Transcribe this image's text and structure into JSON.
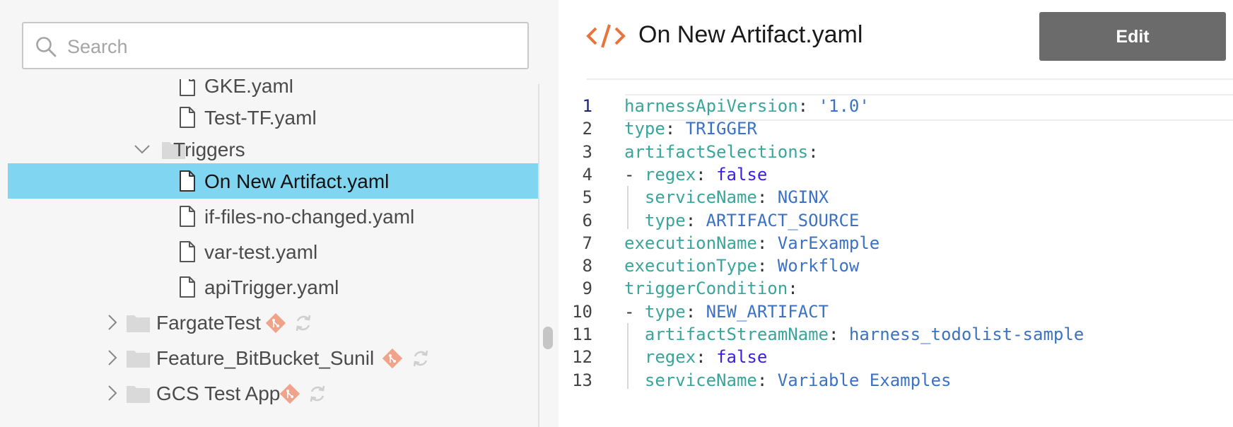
{
  "search": {
    "placeholder": "Search",
    "value": ""
  },
  "tree": {
    "items": [
      {
        "type": "file",
        "label": "GKE.yaml",
        "selected": false
      },
      {
        "type": "file",
        "label": "Test-TF.yaml",
        "selected": false
      },
      {
        "type": "folder",
        "label": "Triggers",
        "expanded": true
      },
      {
        "type": "file",
        "label": "On New Artifact.yaml",
        "selected": true
      },
      {
        "type": "file",
        "label": "if-files-no-changed.yaml",
        "selected": false
      },
      {
        "type": "file",
        "label": "var-test.yaml",
        "selected": false
      },
      {
        "type": "file",
        "label": "apiTrigger.yaml",
        "selected": false
      },
      {
        "type": "folder",
        "label": "FargateTest",
        "expanded": false,
        "git": true
      },
      {
        "type": "folder",
        "label": "Feature_BitBucket_Sunil",
        "expanded": false,
        "git": true
      },
      {
        "type": "folder",
        "label": "GCS Test App",
        "expanded": false,
        "git": true
      }
    ]
  },
  "editor": {
    "file_title": "On New Artifact.yaml",
    "edit_label": "Edit",
    "active_line": 1,
    "lines": [
      {
        "num": "1",
        "tokens": [
          [
            "key",
            "harnessApiVersion"
          ],
          [
            "punc",
            ": "
          ],
          [
            "str",
            "'1.0'"
          ]
        ]
      },
      {
        "num": "2",
        "tokens": [
          [
            "key",
            "type"
          ],
          [
            "punc",
            ": "
          ],
          [
            "val",
            "TRIGGER"
          ]
        ]
      },
      {
        "num": "3",
        "tokens": [
          [
            "key",
            "artifactSelections"
          ],
          [
            "punc",
            ":"
          ]
        ]
      },
      {
        "num": "4",
        "tokens": [
          [
            "dash",
            "- "
          ],
          [
            "key",
            "regex"
          ],
          [
            "punc",
            ": "
          ],
          [
            "bool",
            "false"
          ]
        ]
      },
      {
        "num": "5",
        "tokens": [
          [
            "dash",
            "  "
          ],
          [
            "key",
            "serviceName"
          ],
          [
            "punc",
            ": "
          ],
          [
            "val",
            "NGINX"
          ]
        ]
      },
      {
        "num": "6",
        "tokens": [
          [
            "dash",
            "  "
          ],
          [
            "key",
            "type"
          ],
          [
            "punc",
            ": "
          ],
          [
            "val",
            "ARTIFACT_SOURCE"
          ]
        ]
      },
      {
        "num": "7",
        "tokens": [
          [
            "key",
            "executionName"
          ],
          [
            "punc",
            ": "
          ],
          [
            "val",
            "VarExample"
          ]
        ]
      },
      {
        "num": "8",
        "tokens": [
          [
            "key",
            "executionType"
          ],
          [
            "punc",
            ": "
          ],
          [
            "val",
            "Workflow"
          ]
        ]
      },
      {
        "num": "9",
        "tokens": [
          [
            "key",
            "triggerCondition"
          ],
          [
            "punc",
            ":"
          ]
        ]
      },
      {
        "num": "10",
        "tokens": [
          [
            "dash",
            "- "
          ],
          [
            "key",
            "type"
          ],
          [
            "punc",
            ": "
          ],
          [
            "val",
            "NEW_ARTIFACT"
          ]
        ]
      },
      {
        "num": "11",
        "tokens": [
          [
            "dash",
            "  "
          ],
          [
            "key",
            "artifactStreamName"
          ],
          [
            "punc",
            ": "
          ],
          [
            "val",
            "harness_todolist-sample"
          ]
        ]
      },
      {
        "num": "12",
        "tokens": [
          [
            "dash",
            "  "
          ],
          [
            "key",
            "regex"
          ],
          [
            "punc",
            ": "
          ],
          [
            "bool",
            "false"
          ]
        ]
      },
      {
        "num": "13",
        "tokens": [
          [
            "dash",
            "  "
          ],
          [
            "key",
            "serviceName"
          ],
          [
            "punc",
            ": "
          ],
          [
            "val",
            "Variable Examples"
          ]
        ]
      }
    ]
  },
  "colors": {
    "selected_row": "#80d5f1",
    "accent_orange": "#e8743b",
    "git_badge": "#f0a38a",
    "edit_button": "#6b6b6b"
  }
}
